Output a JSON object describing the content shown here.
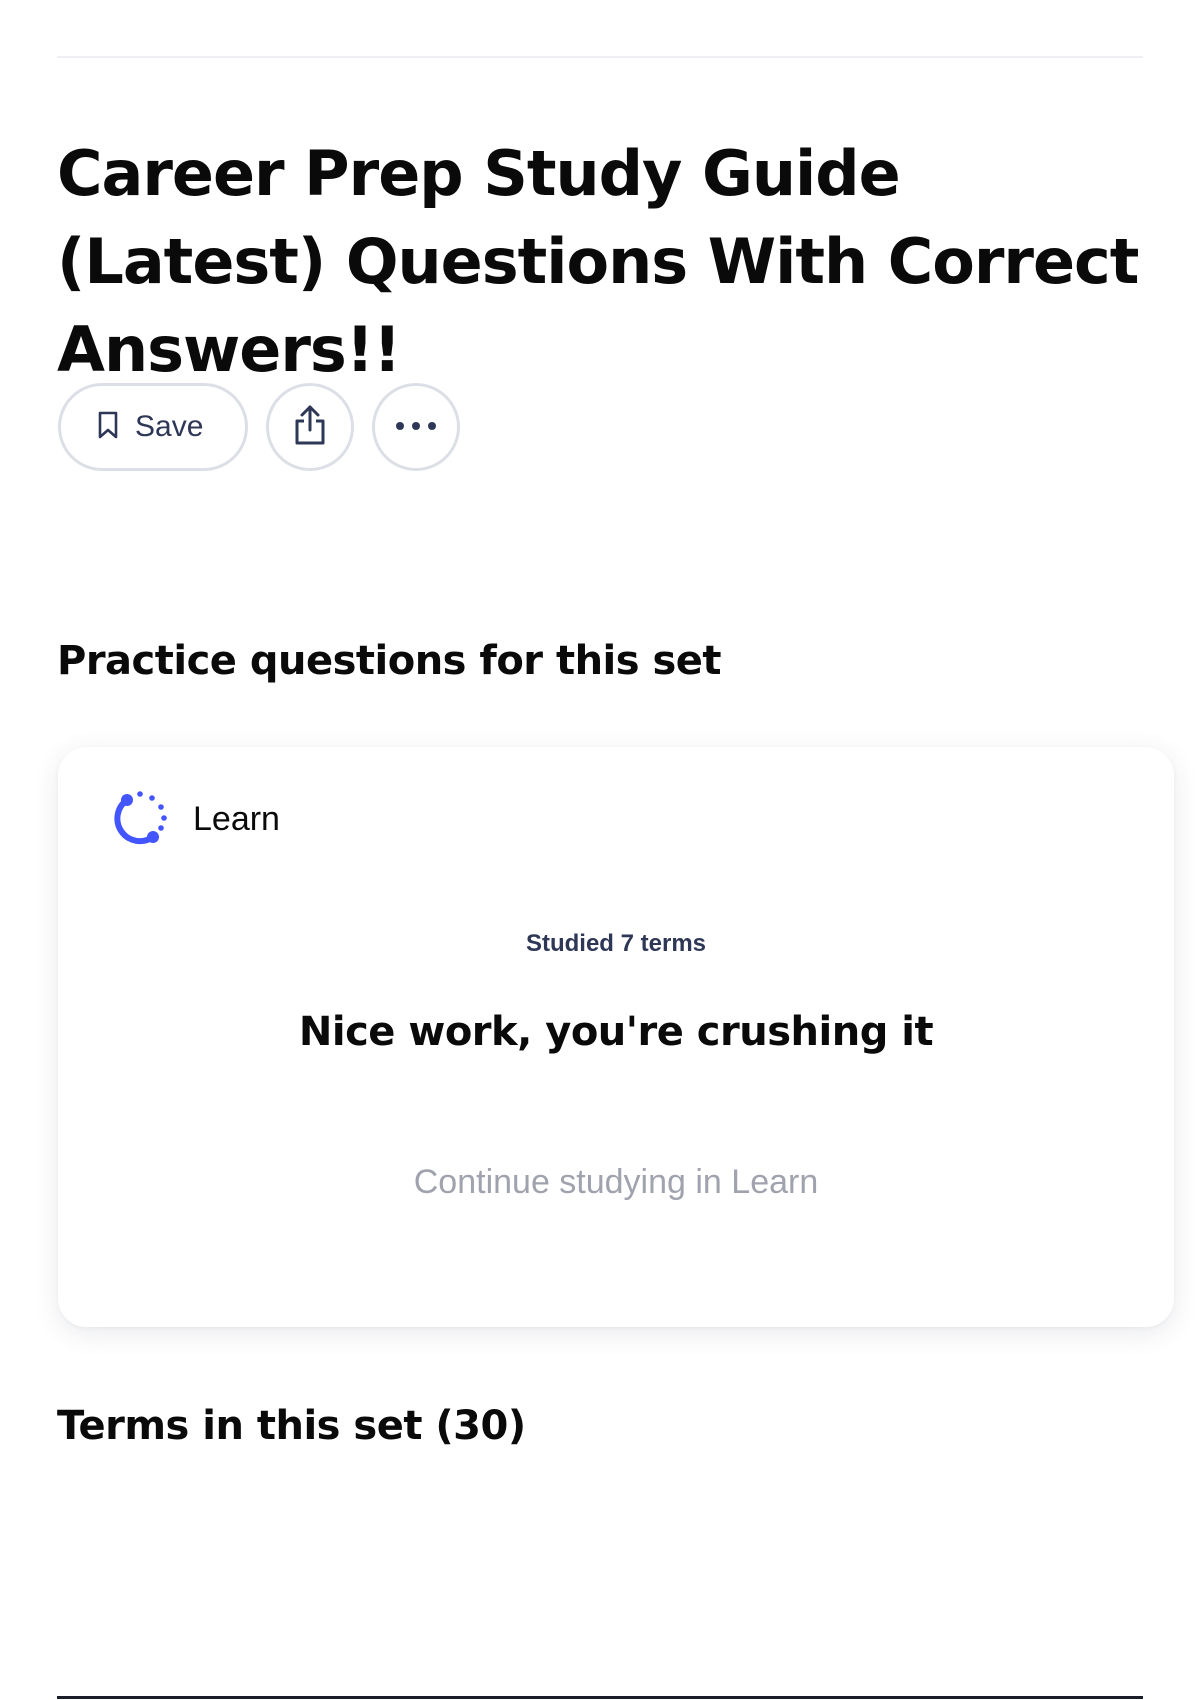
{
  "header": {
    "title": "Career Prep Study Guide (Latest) Questions With Correct Answers!!"
  },
  "actions": {
    "save_label": "Save",
    "save_icon": "bookmark-icon",
    "share_icon": "share-icon",
    "more_icon": "more-icon"
  },
  "practice": {
    "heading": "Practice questions for this set",
    "card": {
      "mode_icon": "learn-icon",
      "mode_label": "Learn",
      "studied": "Studied 7 terms",
      "message": "Nice work, you're crushing it",
      "continue_label": "Continue studying in Learn"
    }
  },
  "terms": {
    "heading": "Terms in this set (30)"
  },
  "colors": {
    "accent": "#4255ff",
    "text_primary": "#0a0a0a",
    "text_secondary": "#2e3856",
    "text_muted": "#a0a3ad",
    "border": "#dcdfe6"
  }
}
